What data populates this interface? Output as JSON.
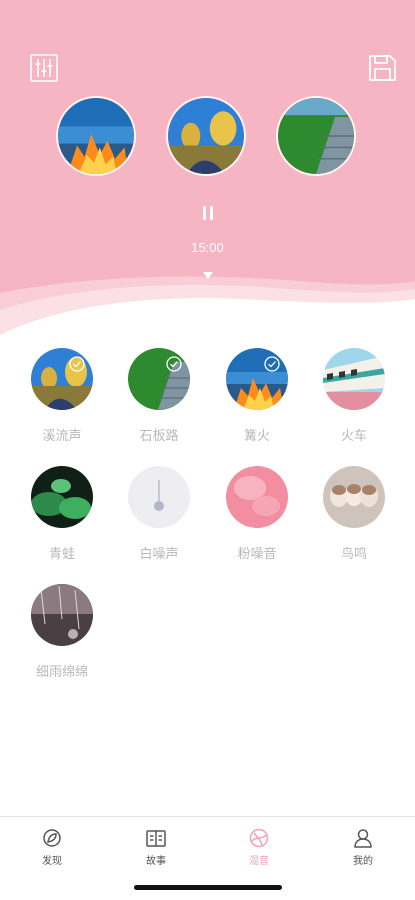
{
  "header": {
    "timer": "15:00",
    "mixer_icon": "mixer-sliders-icon",
    "save_icon": "save-floppy-icon",
    "background_color": "#f6b5c2"
  },
  "selected_sounds": [
    {
      "name": "篝火"
    },
    {
      "name": "溪流声"
    },
    {
      "name": "石板路"
    }
  ],
  "sounds": [
    {
      "label": "溪流声",
      "selected": true
    },
    {
      "label": "石板路",
      "selected": true
    },
    {
      "label": "篝火",
      "selected": true
    },
    {
      "label": "火车",
      "selected": false
    },
    {
      "label": "青蛙",
      "selected": false
    },
    {
      "label": "白噪声",
      "selected": false
    },
    {
      "label": "粉噪音",
      "selected": false
    },
    {
      "label": "鸟鸣",
      "selected": false
    },
    {
      "label": "细雨绵绵",
      "selected": false
    }
  ],
  "tabs": [
    {
      "label": "发现",
      "active": false
    },
    {
      "label": "故事",
      "active": false
    },
    {
      "label": "混音",
      "active": true
    },
    {
      "label": "我的",
      "active": false
    }
  ],
  "colors": {
    "accent": "#f4a0b3",
    "label": "#b9b9b9"
  }
}
